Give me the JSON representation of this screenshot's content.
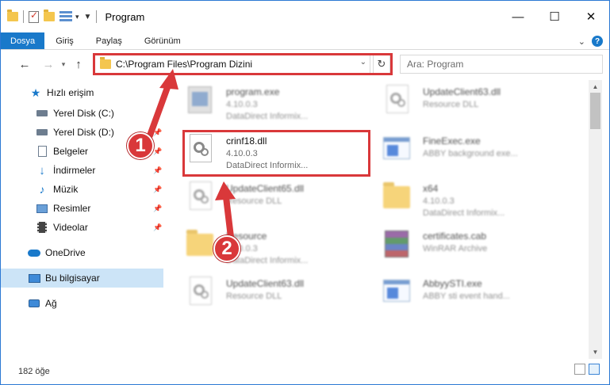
{
  "window": {
    "title": "Program",
    "controls": {
      "minimize": "—",
      "maximize": "☐",
      "close": "✕"
    }
  },
  "ribbon": {
    "tabs": [
      "Dosya",
      "Giriş",
      "Paylaş",
      "Görünüm"
    ],
    "help": "?"
  },
  "address": {
    "path": "C:\\Program Files\\Program Dizini",
    "search_placeholder": "Ara: Program"
  },
  "sidebar": {
    "items": [
      {
        "label": "Hızlı erişim",
        "icon": "star-icon"
      },
      {
        "label": "Yerel Disk (C:)",
        "icon": "drive-icon"
      },
      {
        "label": "Yerel Disk (D:)",
        "icon": "drive-icon"
      },
      {
        "label": "Belgeler",
        "icon": "documents-icon"
      },
      {
        "label": "İndirmeler",
        "icon": "download-icon"
      },
      {
        "label": "Müzik",
        "icon": "music-icon"
      },
      {
        "label": "Resimler",
        "icon": "pictures-icon"
      },
      {
        "label": "Videolar",
        "icon": "video-icon"
      },
      {
        "label": "OneDrive",
        "icon": "cloud-icon"
      },
      {
        "label": "Bu bilgisayar",
        "icon": "computer-icon"
      },
      {
        "label": "Ağ",
        "icon": "network-icon"
      }
    ]
  },
  "files": [
    {
      "name": "program.exe",
      "line1": "4.10.0.3",
      "line2": "DataDirect Informix...",
      "icon": "program-icon"
    },
    {
      "name": "UpdateClient63.dll",
      "line1": "Resource DLL",
      "line2": "",
      "icon": "dll-icon"
    },
    {
      "name": "crinf18.dll",
      "line1": "4.10.0.3",
      "line2": "DataDirect Informix...",
      "icon": "dll-icon"
    },
    {
      "name": "FineExec.exe",
      "line1": "ABBY background exe...",
      "line2": "",
      "icon": "exe-icon"
    },
    {
      "name": "UpdateClient65.dll",
      "line1": "Resource DLL",
      "line2": "",
      "icon": "dll-icon"
    },
    {
      "name": "x64",
      "line1": "4.10.0.3",
      "line2": "DataDirect Informix...",
      "icon": "folder-icon"
    },
    {
      "name": "Resource",
      "line1": "4.10.0.3",
      "line2": "DataDirect Informix...",
      "icon": "folder-icon"
    },
    {
      "name": "certificates.cab",
      "line1": "WinRAR Archive",
      "line2": "",
      "icon": "rar-icon"
    },
    {
      "name": "UpdateClient63.dll",
      "line1": "Resource DLL",
      "line2": "",
      "icon": "dll-icon"
    },
    {
      "name": "AbbyySTI.exe",
      "line1": "ABBY sti event hand...",
      "line2": "",
      "icon": "exe-icon"
    }
  ],
  "callouts": [
    "1",
    "2"
  ],
  "status": {
    "count": "182 öğe"
  },
  "colors": {
    "accent": "#1979ca",
    "highlight": "#d9383a",
    "selection": "#cce4f7"
  }
}
